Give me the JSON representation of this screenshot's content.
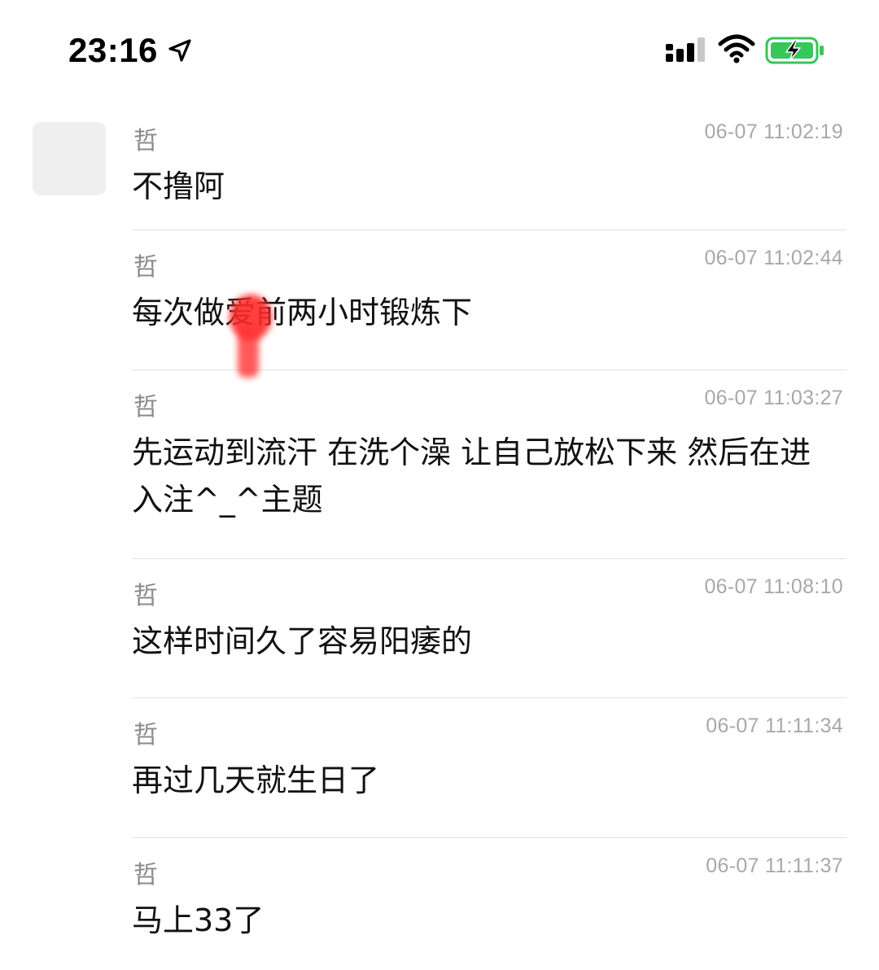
{
  "status_bar": {
    "time": "23:16",
    "location_icon": "location-arrow-icon",
    "signal_icon": "cellular-signal-icon",
    "wifi_icon": "wifi-icon",
    "battery_icon": "battery-charging-icon",
    "battery_color": "#34c759"
  },
  "conversation": {
    "avatar_color": "#efefef",
    "messages": [
      {
        "sender": "哲",
        "timestamp": "06-07 11:02:19",
        "text": "不撸阿"
      },
      {
        "sender": "哲",
        "timestamp": "06-07 11:02:44",
        "text": "每次做爱前两小时锻炼下"
      },
      {
        "sender": "哲",
        "timestamp": "06-07 11:03:27",
        "text": "先运动到流汗 在洗个澡 让自己放松下来 然后在进入注^_^主题"
      },
      {
        "sender": "哲",
        "timestamp": "06-07 11:08:10",
        "text": "这样时间久了容易阳痿的"
      },
      {
        "sender": "哲",
        "timestamp": "06-07 11:11:34",
        "text": "再过几天就生日了"
      },
      {
        "sender": "哲",
        "timestamp": "06-07 11:11:37",
        "text": "马上33了"
      }
    ]
  },
  "redaction_color": "#ff2a2a"
}
